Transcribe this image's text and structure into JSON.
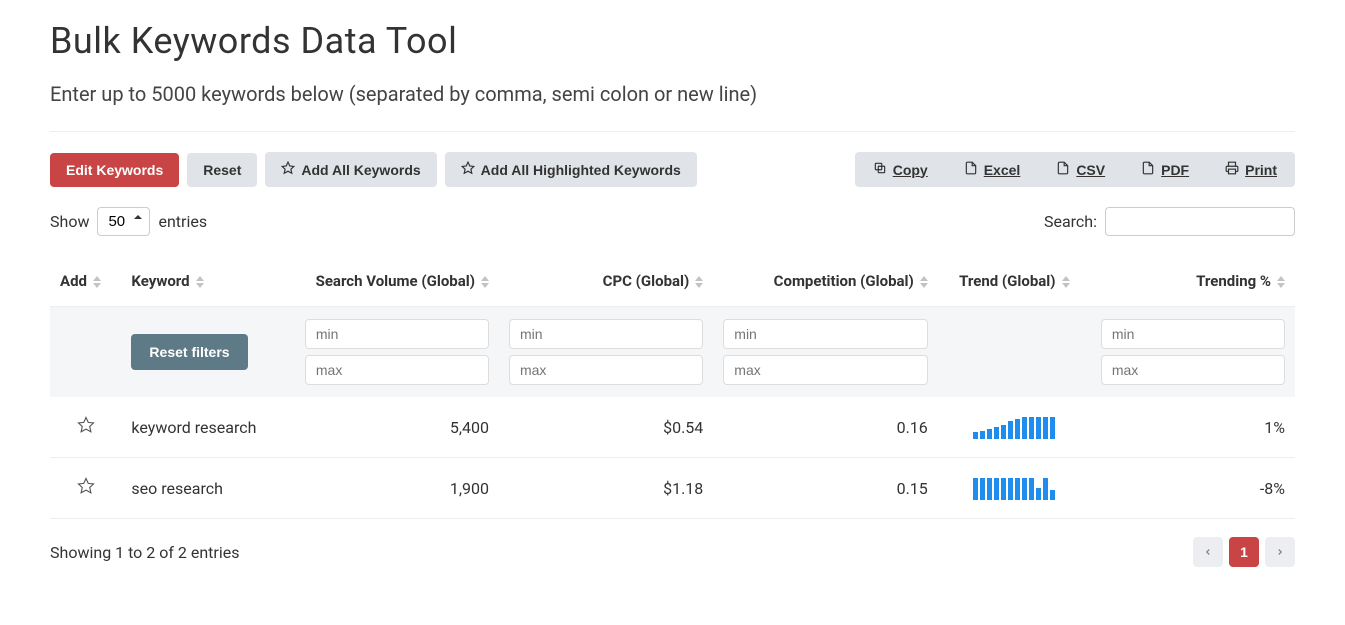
{
  "page": {
    "title": "Bulk Keywords Data Tool",
    "subtitle": "Enter up to 5000 keywords below (separated by comma, semi colon or new line)"
  },
  "toolbar": {
    "edit_keywords": "Edit Keywords",
    "reset": "Reset",
    "add_all": "Add All Keywords",
    "add_all_highlighted": "Add All Highlighted Keywords"
  },
  "export": {
    "copy": "Copy",
    "excel": "Excel",
    "csv": "CSV",
    "pdf": "PDF",
    "print": "Print"
  },
  "table_controls": {
    "show_label_pre": "Show",
    "show_value": "50",
    "show_label_post": "entries",
    "search_label": "Search:",
    "search_value": ""
  },
  "columns": {
    "add": "Add",
    "keyword": "Keyword",
    "search_volume": "Search Volume (Global)",
    "cpc": "CPC (Global)",
    "competition": "Competition (Global)",
    "trend": "Trend (Global)",
    "trending_pct": "Trending %"
  },
  "filters": {
    "reset_label": "Reset filters",
    "min_placeholder": "min",
    "max_placeholder": "max"
  },
  "rows": [
    {
      "keyword": "keyword research",
      "search_volume": "5,400",
      "cpc": "$0.54",
      "competition": "0.16",
      "trend": [
        7,
        8,
        10,
        12,
        14,
        18,
        20,
        22,
        22,
        22,
        22,
        22
      ],
      "trending_pct": "1%"
    },
    {
      "keyword": "seo research",
      "search_volume": "1,900",
      "cpc": "$1.18",
      "competition": "0.15",
      "trend": [
        22,
        22,
        22,
        22,
        22,
        22,
        22,
        22,
        22,
        12,
        22,
        10
      ],
      "trending_pct": "-8%"
    }
  ],
  "footer": {
    "info": "Showing 1 to 2 of 2 entries",
    "current_page": "1"
  }
}
